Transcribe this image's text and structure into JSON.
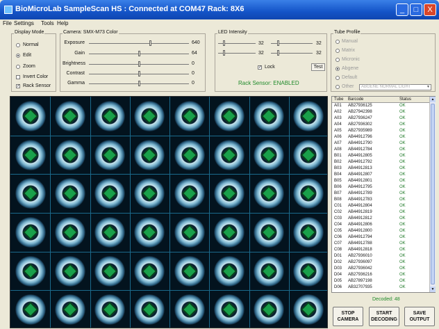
{
  "window": {
    "title": "BioMicroLab SampleScan HS : Connected at COM47   Rack: 8X6",
    "min": "_",
    "max": "□",
    "close": "X"
  },
  "menu": [
    "File",
    "Settings",
    "Tools",
    "Help"
  ],
  "display_mode": {
    "title": "Display Mode",
    "options": [
      {
        "label": "Normal",
        "selected": false
      },
      {
        "label": "Edit",
        "selected": true
      },
      {
        "label": "Zoom",
        "selected": false
      }
    ],
    "invert_color": {
      "label": "Invert Color",
      "checked": false
    },
    "rack_sensor": {
      "label": "Rack Sensor",
      "checked": true
    }
  },
  "camera": {
    "title": "Camera: SMX-M73 Color",
    "controls": [
      {
        "label": "Exposure",
        "value": "640",
        "level": 0.62
      },
      {
        "label": "Gain",
        "value": "64",
        "level": 0.51
      },
      {
        "label": "Brightness",
        "value": "0",
        "level": 0.51
      },
      {
        "label": "Contrast",
        "value": "0",
        "level": 0.51
      },
      {
        "label": "Gamma",
        "value": "0",
        "level": 0.51
      }
    ]
  },
  "led": {
    "title": "LED Intensity",
    "values": [
      "32",
      "32",
      "32",
      "32"
    ],
    "lock": {
      "label": "Lock",
      "checked": true
    },
    "test": "Test",
    "sensor_status": "Rack Sensor: ENABLED"
  },
  "tube_profile": {
    "title": "Tube Profile",
    "options": [
      "Manual",
      "Matrix",
      "Micronic",
      "Abgene",
      "Default",
      "Other"
    ],
    "selected": "Abgene",
    "other_value": "ABGENE NORMAL LIGHT"
  },
  "table": {
    "headers": [
      "Tube",
      "Barcode",
      "Status"
    ],
    "rows": [
      {
        "tube": "A01",
        "barcode": "AB27936125",
        "status": "OK"
      },
      {
        "tube": "A02",
        "barcode": "AB27942398",
        "status": "OK"
      },
      {
        "tube": "A03",
        "barcode": "AB27936247",
        "status": "OK"
      },
      {
        "tube": "A04",
        "barcode": "AB27936302",
        "status": "OK"
      },
      {
        "tube": "A05",
        "barcode": "AB27935989",
        "status": "OK"
      },
      {
        "tube": "A06",
        "barcode": "AB44912796",
        "status": "OK"
      },
      {
        "tube": "A07",
        "barcode": "AB44912790",
        "status": "OK"
      },
      {
        "tube": "A08",
        "barcode": "AB44912784",
        "status": "OK"
      },
      {
        "tube": "B01",
        "barcode": "AB44912805",
        "status": "OK"
      },
      {
        "tube": "B02",
        "barcode": "AB44912792",
        "status": "OK"
      },
      {
        "tube": "B03",
        "barcode": "AB44912813",
        "status": "OK"
      },
      {
        "tube": "B04",
        "barcode": "AB44912807",
        "status": "OK"
      },
      {
        "tube": "B05",
        "barcode": "AB44912801",
        "status": "OK"
      },
      {
        "tube": "B06",
        "barcode": "AB44912795",
        "status": "OK"
      },
      {
        "tube": "B07",
        "barcode": "AB44912789",
        "status": "OK"
      },
      {
        "tube": "B08",
        "barcode": "AB44912783",
        "status": "OK"
      },
      {
        "tube": "C01",
        "barcode": "AB44912804",
        "status": "OK"
      },
      {
        "tube": "C02",
        "barcode": "AB44912819",
        "status": "OK"
      },
      {
        "tube": "C03",
        "barcode": "AB44912812",
        "status": "OK"
      },
      {
        "tube": "C04",
        "barcode": "AB44912806",
        "status": "OK"
      },
      {
        "tube": "C05",
        "barcode": "AB44912800",
        "status": "OK"
      },
      {
        "tube": "C06",
        "barcode": "AB44912794",
        "status": "OK"
      },
      {
        "tube": "C07",
        "barcode": "AB44912788",
        "status": "OK"
      },
      {
        "tube": "C08",
        "barcode": "AB44912818",
        "status": "OK"
      },
      {
        "tube": "D01",
        "barcode": "AB27936010",
        "status": "OK"
      },
      {
        "tube": "D02",
        "barcode": "AB27936097",
        "status": "OK"
      },
      {
        "tube": "D03",
        "barcode": "AB27936042",
        "status": "OK"
      },
      {
        "tube": "D04",
        "barcode": "AB27936216",
        "status": "OK"
      },
      {
        "tube": "D05",
        "barcode": "AB27897198",
        "status": "OK"
      },
      {
        "tube": "D06",
        "barcode": "AB32707935",
        "status": "OK"
      }
    ]
  },
  "decoded": "Decoded: 48",
  "buttons": {
    "stop": [
      "STOP",
      "CAMERA"
    ],
    "start": [
      "START",
      "DECODING"
    ],
    "save": [
      "SAVE",
      "OUTPUT"
    ]
  }
}
